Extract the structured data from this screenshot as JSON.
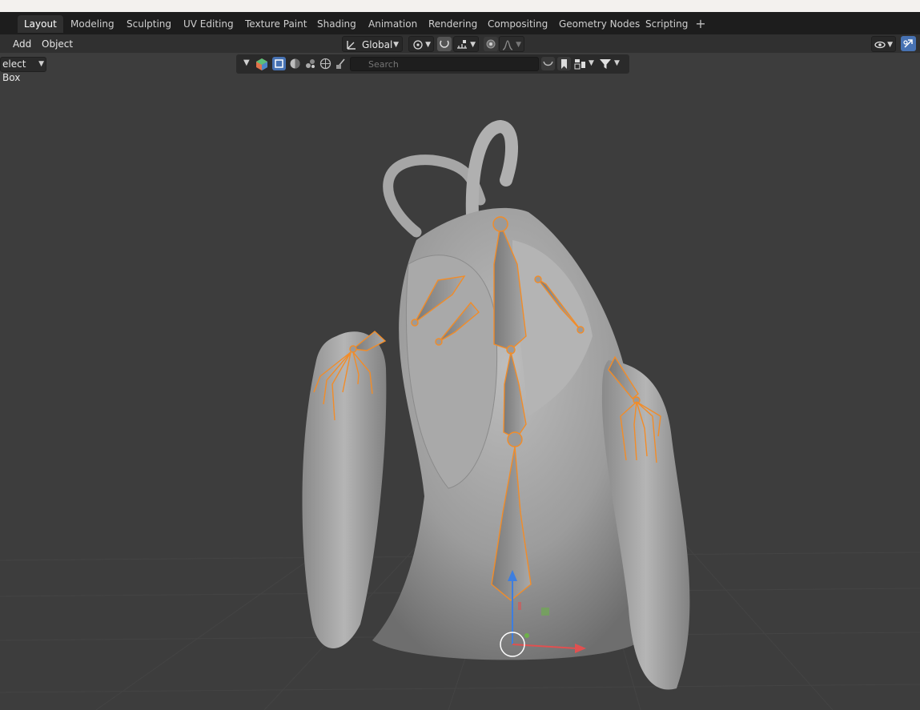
{
  "workspaces": {
    "tabs": [
      {
        "label": "Layout",
        "active": true
      },
      {
        "label": "Modeling",
        "active": false
      },
      {
        "label": "Sculpting",
        "active": false
      },
      {
        "label": "UV Editing",
        "active": false
      },
      {
        "label": "Texture Paint",
        "active": false
      },
      {
        "label": "Shading",
        "active": false
      },
      {
        "label": "Animation",
        "active": false
      },
      {
        "label": "Rendering",
        "active": false
      },
      {
        "label": "Compositing",
        "active": false
      },
      {
        "label": "Geometry Nodes",
        "active": false
      },
      {
        "label": "Scripting",
        "active": false
      }
    ],
    "add_label": "+"
  },
  "header": {
    "menus": {
      "add": "Add",
      "object": "Object"
    },
    "transform_orientation": "Global",
    "icons": [
      "orientation-icon",
      "pivot-icon",
      "snap-icon",
      "snap-increment-icon",
      "proportional-edit-icon",
      "falloff-icon",
      "visibility-icon",
      "gizmo-icon"
    ]
  },
  "toolbar": {
    "select_mode": "elect Box"
  },
  "outliner_filter": {
    "search_placeholder": "Search"
  },
  "colors": {
    "accent": "#4772b3",
    "selection_orange": "#f28c28",
    "viewport_bg": "#3d3d3d",
    "header_bg": "#303030",
    "tabs_bg": "#1d1d1d"
  }
}
